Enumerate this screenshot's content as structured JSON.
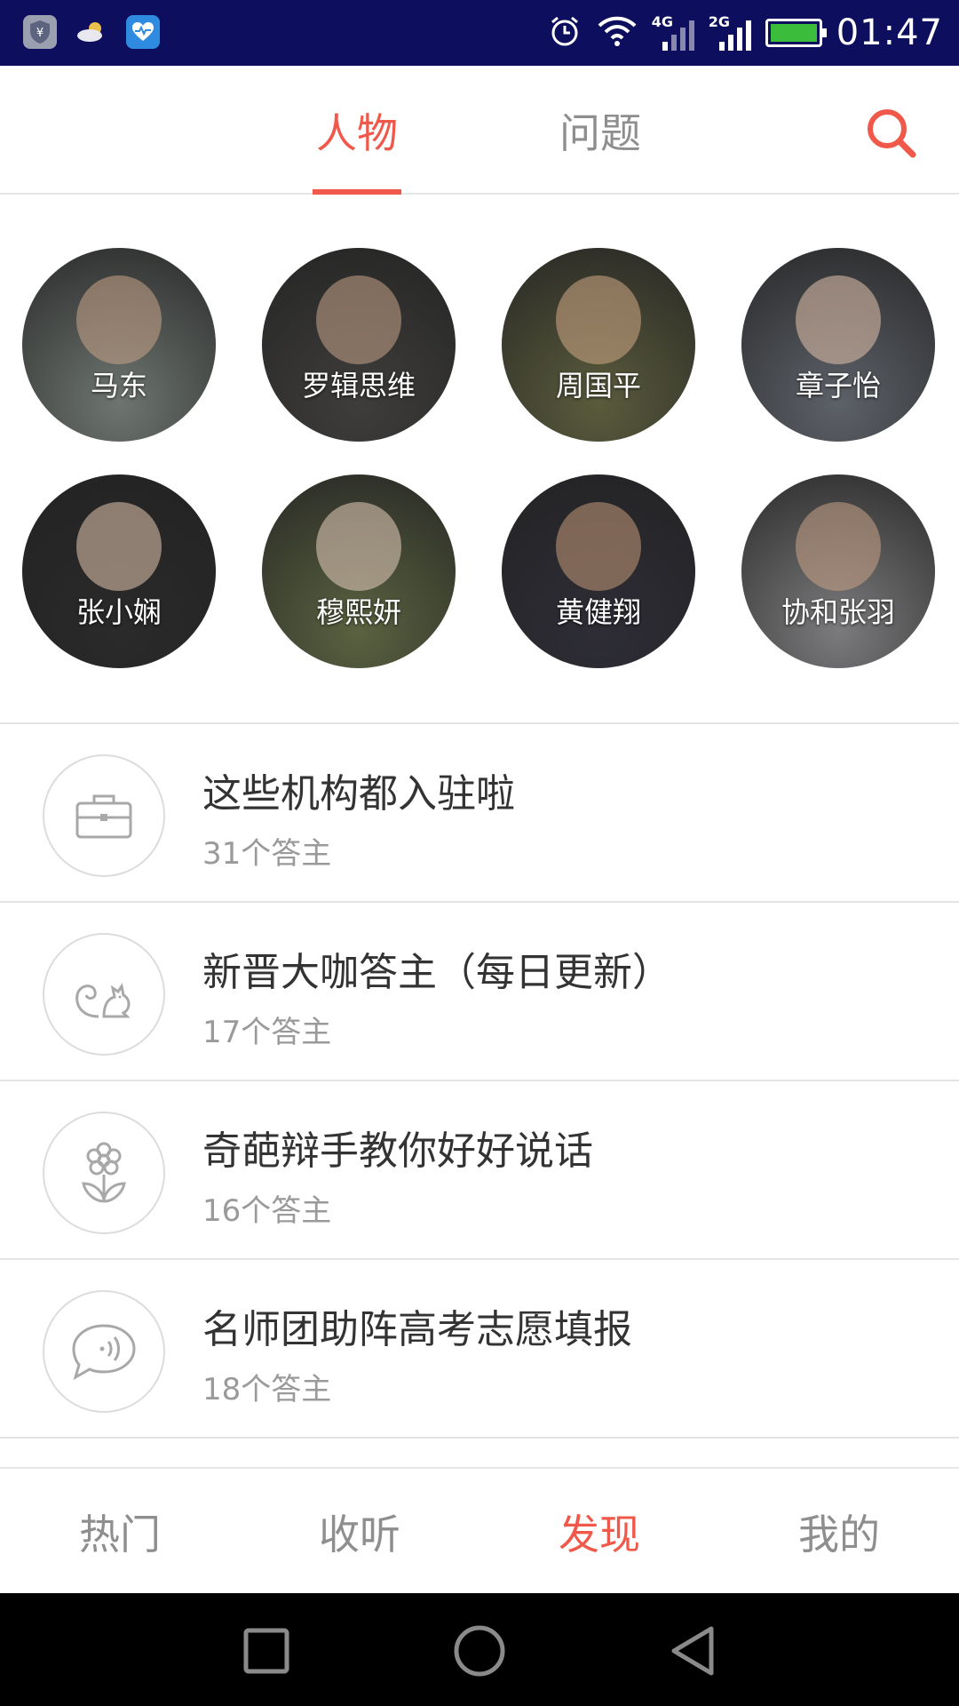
{
  "status_bar": {
    "time": "01:47",
    "network_1": "4G",
    "network_2": "2G",
    "icons": [
      "shield-app-icon",
      "cloud-icon",
      "health-app-icon",
      "alarm-icon",
      "wifi-icon",
      "signal-icon",
      "battery-icon"
    ]
  },
  "top_tabs": {
    "tabs": [
      {
        "label": "人物",
        "active": true
      },
      {
        "label": "问题",
        "active": false
      }
    ],
    "search_icon": "search-icon",
    "accent_color": "#f0584a"
  },
  "people": [
    {
      "name": "马东",
      "bg": "#6e7570",
      "face": "#c9a488"
    },
    {
      "name": "罗辑思维",
      "bg": "#3e3d3b",
      "face": "#c9a488"
    },
    {
      "name": "周国平",
      "bg": "#5a5b3c",
      "face": "#d2a987"
    },
    {
      "name": "章子怡",
      "bg": "#5d6168",
      "face": "#e3c3ad"
    },
    {
      "name": "张小娴",
      "bg": "#2a2a2a",
      "face": "#e6c8b2"
    },
    {
      "name": "穆熙妍",
      "bg": "#5a6240",
      "face": "#e8cdbd"
    },
    {
      "name": "黄健翔",
      "bg": "#2e2d36",
      "face": "#c79b7a"
    },
    {
      "name": "协和张羽",
      "bg": "#7b7b7d",
      "face": "#c9a386"
    }
  ],
  "categories": [
    {
      "title": "这些机构都入驻啦",
      "count": "31个答主",
      "icon": "briefcase-icon"
    },
    {
      "title": "新晋大咖答主（每日更新）",
      "count": "17个答主",
      "icon": "squirrel-icon"
    },
    {
      "title": "奇葩辩手教你好好说话",
      "count": "16个答主",
      "icon": "flower-icon"
    },
    {
      "title": "名师团助阵高考志愿填报",
      "count": "18个答主",
      "icon": "speech-bubble-icon"
    }
  ],
  "bottom_nav": {
    "items": [
      {
        "label": "热门",
        "active": false
      },
      {
        "label": "收听",
        "active": false
      },
      {
        "label": "发现",
        "active": true
      },
      {
        "label": "我的",
        "active": false
      }
    ]
  }
}
